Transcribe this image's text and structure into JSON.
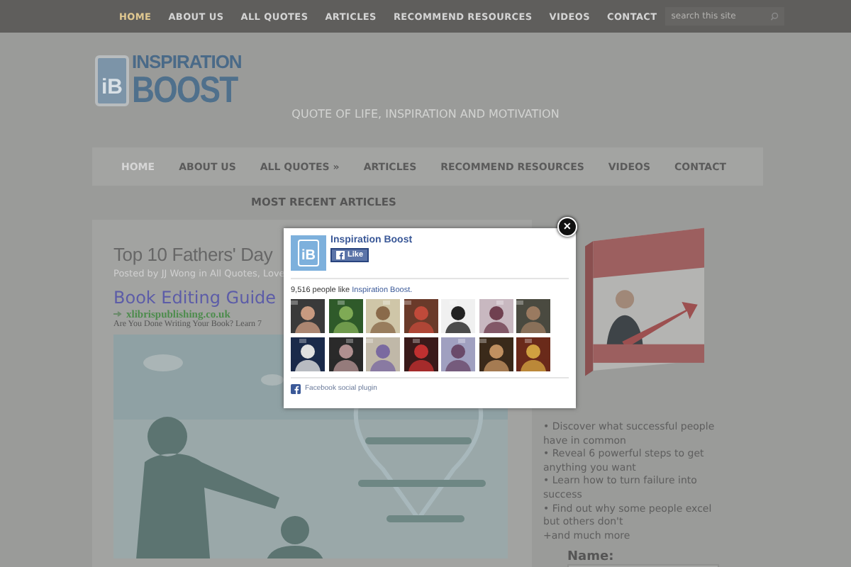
{
  "top_nav": {
    "items": [
      {
        "label": "HOME",
        "selected": true
      },
      {
        "label": "ABOUT US",
        "selected": false
      },
      {
        "label": "ALL QUOTES",
        "selected": false
      },
      {
        "label": "ARTICLES",
        "selected": false
      },
      {
        "label": "RECOMMEND RESOURCES",
        "selected": false
      },
      {
        "label": "VIDEOS",
        "selected": false
      },
      {
        "label": "CONTACT",
        "selected": false
      }
    ],
    "search": {
      "placeholder": "search this site"
    }
  },
  "logo": {
    "mark": "iB",
    "line1": "INSPIRATION",
    "line2": "BOOST"
  },
  "tagline": "QUOTE OF LIFE, INSPIRATION AND MOTIVATION",
  "main_nav": {
    "items": [
      {
        "label": "HOME",
        "selected": true
      },
      {
        "label": "ABOUT US",
        "selected": false
      },
      {
        "label": "ALL QUOTES »",
        "selected": false
      },
      {
        "label": "ARTICLES",
        "selected": false
      },
      {
        "label": "RECOMMEND RESOURCES",
        "selected": false
      },
      {
        "label": "VIDEOS",
        "selected": false
      },
      {
        "label": "CONTACT",
        "selected": false
      }
    ]
  },
  "section_title": "MOST RECENT ARTICLES",
  "article": {
    "title": "Top 10 Fathers' Day",
    "meta": "Posted by JJ Wong in All Quotes, Love",
    "ad": {
      "title": "Book Editing Guide",
      "url": "xlibrispublishing.co.uk",
      "text": "Are You Done Writing Your Book? Learn 7"
    }
  },
  "sidebar": {
    "bullets": [
      "• Discover what successful people have in common",
      "• Reveal 6 powerful steps to get anything you want",
      "• Learn how to turn failure into success",
      "• Find out why some people excel but others don't",
      "+and much more"
    ],
    "name_label": "Name:"
  },
  "popup": {
    "page_name": "Inspiration Boost",
    "logo": "iB",
    "like_button": "Like",
    "count_text": "9,516 people like",
    "count_link": "Inspiration Boost.",
    "footer": "Facebook social plugin",
    "close": "✕"
  }
}
